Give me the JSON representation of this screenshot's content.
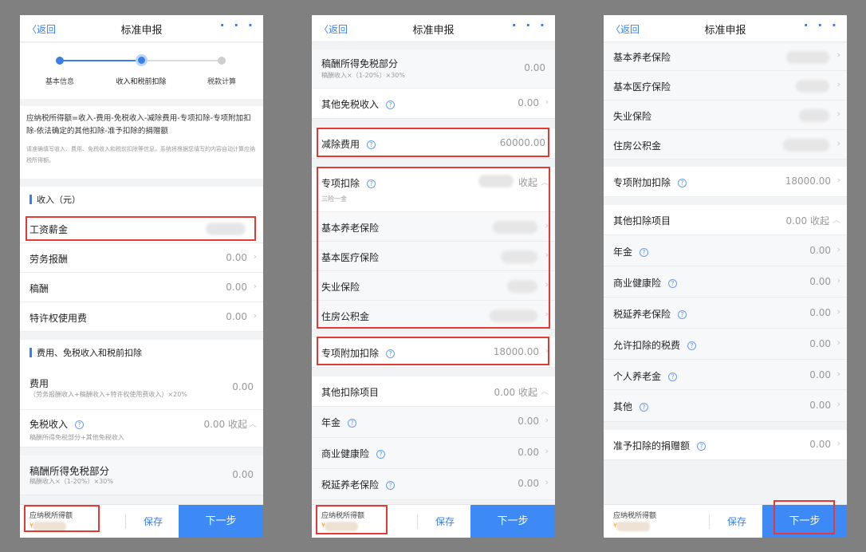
{
  "nav": {
    "back": "返回",
    "title": "标准申报",
    "more": "· · ·"
  },
  "common": {
    "chevron": "›",
    "chevron_up": "︿",
    "help": "?"
  },
  "footer": {
    "label": "应纳税所得额",
    "value": "¥",
    "save": "保存",
    "next": "下一步"
  },
  "p1": {
    "steps": [
      "基本信息",
      "收入和税前扣除",
      "税款计算"
    ],
    "current_step": 2,
    "formula": "应纳税所得额=收入-费用-免税收入-减除费用-专项扣除-专项附加扣除-依法确定的其他扣除-准予扣除的捐赠额",
    "note": "请准确填写收入、费用、免税收入和税前扣除等信息，系统将根据您填写的内容自动计算应纳税所得额。",
    "income_section": "收入（元）",
    "salary": "工资薪金",
    "labor": {
      "label": "劳务报酬",
      "value": "0.00"
    },
    "royalty": {
      "label": "稿酬",
      "value": "0.00"
    },
    "franchise": {
      "label": "特许权使用费",
      "value": "0.00"
    },
    "expense_section": "费用、免税收入和税前扣除",
    "expense": {
      "label": "费用",
      "sub": "（劳务报酬收入+稿酬收入+特许权使用费收入）×20%",
      "value": "0.00"
    },
    "exempt": {
      "label": "免税收入",
      "value": "0.00 收起",
      "sub": "稿酬所得免税部分+其他免税收入"
    },
    "royalty_exempt": {
      "label": "稿酬所得免税部分",
      "sub": "稿酬收入×（1-20%）×30%",
      "value": "0.00"
    }
  },
  "p2": {
    "royalty_exempt": {
      "label": "稿酬所得免税部分",
      "sub": "稿酬收入×（1-20%）×30%",
      "value": "0.00"
    },
    "other_exempt": {
      "label": "其他免税收入",
      "value": "0.00"
    },
    "deduction": {
      "label": "减除费用",
      "value": "60000.00"
    },
    "special": {
      "label": "专项扣除",
      "sub": "三险一金",
      "toggle": "收起"
    },
    "pension": "基本养老保险",
    "medical": "基本医疗保险",
    "unemployment": "失业保险",
    "housing": "住房公积金",
    "special_add": {
      "label": "专项附加扣除",
      "value": "18000.00"
    },
    "other_items": {
      "label": "其他扣除项目",
      "value": "0.00 收起"
    },
    "annuity": {
      "label": "年金",
      "value": "0.00"
    },
    "health": {
      "label": "商业健康险",
      "value": "0.00"
    },
    "deferred": {
      "label": "税延养老保险",
      "value": "0.00"
    }
  },
  "p3": {
    "pension": "基本养老保险",
    "medical": "基本医疗保险",
    "unemployment": "失业保险",
    "housing": "住房公积金",
    "special_add": {
      "label": "专项附加扣除",
      "value": "18000.00"
    },
    "other_items": {
      "label": "其他扣除项目",
      "value": "0.00 收起"
    },
    "annuity": {
      "label": "年金",
      "value": "0.00"
    },
    "health": {
      "label": "商业健康险",
      "value": "0.00"
    },
    "deferred": {
      "label": "税延养老保险",
      "value": "0.00"
    },
    "tax_allowed": {
      "label": "允许扣除的税费",
      "value": "0.00"
    },
    "personal_pension": {
      "label": "个人养老金",
      "value": "0.00"
    },
    "others": {
      "label": "其他",
      "value": "0.00"
    },
    "donation": {
      "label": "准予扣除的捐赠额",
      "value": "0.00"
    }
  },
  "colors": {
    "accent": "#3d8af7",
    "highlight": "#e53935",
    "value_gray": "#999999"
  }
}
